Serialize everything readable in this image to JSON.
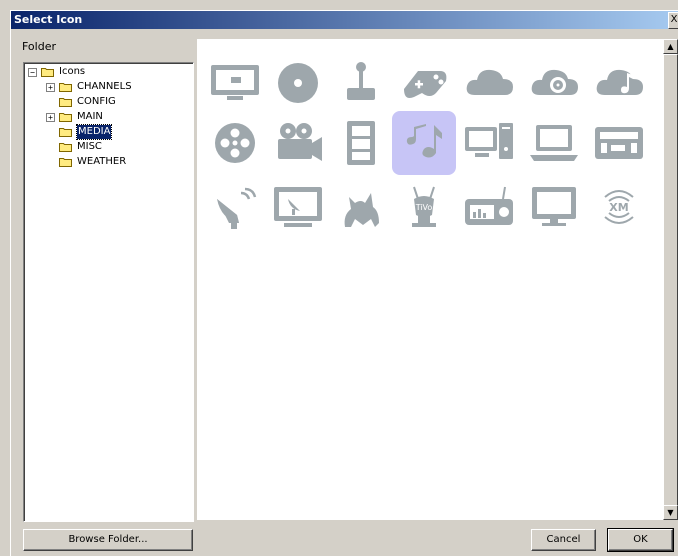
{
  "window": {
    "title": "Select Icon",
    "close_glyph": "X"
  },
  "folder_panel": {
    "label": "Folder"
  },
  "tree": [
    {
      "label": "Icons",
      "expander": "−",
      "selected": false
    },
    {
      "label": "CHANNELS",
      "expander": "+",
      "selected": false
    },
    {
      "label": "CONFIG",
      "expander": "",
      "selected": false
    },
    {
      "label": "MAIN",
      "expander": "+",
      "selected": false
    },
    {
      "label": "MEDIA",
      "expander": "",
      "selected": true
    },
    {
      "label": "MISC",
      "expander": "",
      "selected": false
    },
    {
      "label": "WEATHER",
      "expander": "",
      "selected": false
    }
  ],
  "icons": [
    "monitor-icon",
    "disc-icon",
    "joystick-icon",
    "gamepad-icon",
    "cloud-icon",
    "film-cloud-icon",
    "music-cloud-icon",
    "film-reel-icon",
    "movie-camera-icon",
    "film-strip-icon",
    "music-notes-icon",
    "computer-icon",
    "laptop-icon",
    "radio-icon",
    "satellite-dish-icon",
    "satellite-tv-icon",
    "dog-icon",
    "tivo-icon",
    "retro-radio-icon",
    "monitor-stand-icon",
    "xm-radio-icon"
  ],
  "selected_icon": "music-notes-icon",
  "colors": {
    "icon": "#9ea7ac",
    "selection": "#c7c5f6",
    "titlebar": "#0a246a"
  },
  "buttons": {
    "browse": "Browse Folder...",
    "cancel": "Cancel",
    "ok": "OK"
  },
  "scrollbar": {
    "up": "▲",
    "down": "▼"
  }
}
